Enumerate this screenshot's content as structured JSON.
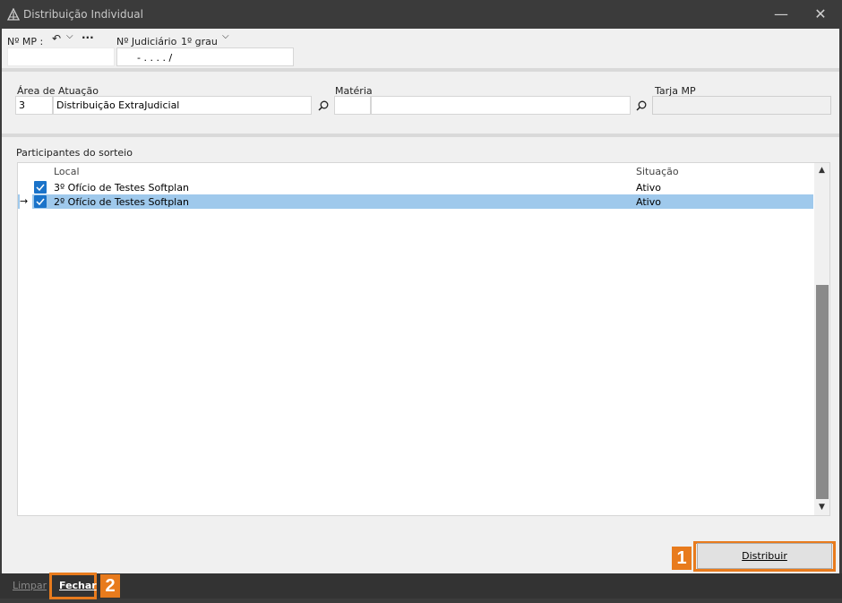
{
  "window": {
    "title": "Distribuição Individual",
    "minimize": "—",
    "close": "✕"
  },
  "header": {
    "mp_label": "Nº MP :",
    "mp_value": "",
    "judiciario_label": "Nº Judiciário",
    "grau_value": "1º grau",
    "judiciario_mask": "-  .   .  .  .  /"
  },
  "filters": {
    "area_label": "Área de Atuação",
    "area_code": "3",
    "area_name": "Distribuição ExtraJudicial",
    "materia_label": "Matéria",
    "materia_code": "",
    "materia_name": "",
    "tarja_label": "Tarja MP",
    "tarja_value": ""
  },
  "participants": {
    "section_label": "Participantes do sorteio",
    "columns": {
      "local": "Local",
      "situacao": "Situação"
    },
    "rows": [
      {
        "local": "3º Ofício de Testes Softplan",
        "situacao": "Ativo",
        "checked": true,
        "selected": false
      },
      {
        "local": "2º Ofício de Testes Softplan",
        "situacao": "Ativo",
        "checked": true,
        "selected": true
      }
    ],
    "current_row_marker": "→"
  },
  "actions": {
    "distribuir_label": "Distribuir",
    "limpar_label": "Limpar",
    "fechar_label": "Fechar"
  },
  "callouts": {
    "first": "1",
    "second": "2"
  },
  "colors": {
    "accent": "#e87b1d",
    "selection": "#9fc9ec",
    "checkbox": "#1a73c9",
    "titlebar": "#3b3b3b"
  }
}
